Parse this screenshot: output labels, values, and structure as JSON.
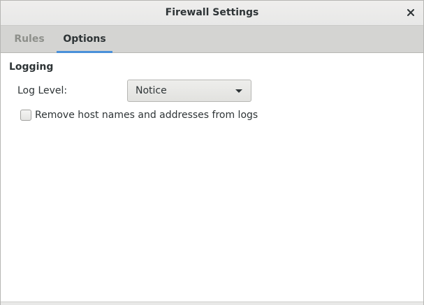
{
  "window": {
    "title": "Firewall Settings"
  },
  "icons": {
    "close": "close-icon",
    "dropdown": "chevron-down-icon"
  },
  "tabs": [
    {
      "label": "Rules",
      "active": false
    },
    {
      "label": "Options",
      "active": true
    }
  ],
  "logging": {
    "section_title": "Logging",
    "log_level_label": "Log Level:",
    "log_level_value": "Notice",
    "remove_hosts_label": "Remove host names and addresses from logs",
    "remove_hosts_checked": false
  },
  "colors": {
    "accent": "#4a90d9",
    "inactive_tab_text": "#8d8f8a",
    "tabbar_bg": "#d4d4d2"
  }
}
